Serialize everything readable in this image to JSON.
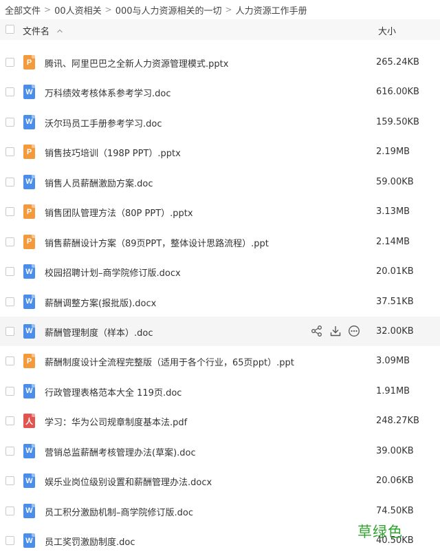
{
  "breadcrumb": {
    "items": [
      "全部文件",
      "00人资相关",
      "000与人力资源相关的一切",
      "人力资源工作手册"
    ],
    "separator": ">"
  },
  "table": {
    "header_name": "文件名",
    "header_size": "大小",
    "rows": [
      {
        "name": "腾讯、阿里巴巴之全新人力资源管理模式.pptx",
        "size": "265.24KB",
        "type": "ppt",
        "icon": "P"
      },
      {
        "name": "万科绩效考核体系参考学习.doc",
        "size": "616.00KB",
        "type": "word",
        "icon": "W"
      },
      {
        "name": "沃尔玛员工手册参考学习.doc",
        "size": "159.50KB",
        "type": "word",
        "icon": "W"
      },
      {
        "name": "销售技巧培训（198P PPT）.pptx",
        "size": "2.19MB",
        "type": "ppt",
        "icon": "P"
      },
      {
        "name": "销售人员薪酬激励方案.doc",
        "size": "59.00KB",
        "type": "word",
        "icon": "W"
      },
      {
        "name": "销售团队管理方法（80P PPT）.pptx",
        "size": "3.13MB",
        "type": "ppt",
        "icon": "P"
      },
      {
        "name": "销售薪酬设计方案（89页PPT，整体设计思路流程）.ppt",
        "size": "2.14MB",
        "type": "ppt",
        "icon": "P"
      },
      {
        "name": "校园招聘计划–商学院修订版.docx",
        "size": "20.01KB",
        "type": "word",
        "icon": "W"
      },
      {
        "name": "薪酬调整方案(报批版).docx",
        "size": "37.51KB",
        "type": "word",
        "icon": "W"
      },
      {
        "name": "薪酬管理制度（样本）.doc",
        "size": "32.00KB",
        "type": "word",
        "icon": "W"
      },
      {
        "name": "薪酬制度设计全流程完整版（适用于各个行业，65页ppt）.ppt",
        "size": "3.09MB",
        "type": "ppt",
        "icon": "P"
      },
      {
        "name": "行政管理表格范本大全 119页.doc",
        "size": "1.91MB",
        "type": "word",
        "icon": "W"
      },
      {
        "name": "学习：华为公司规章制度基本法.pdf",
        "size": "248.27KB",
        "type": "pdf",
        "icon": "人"
      },
      {
        "name": "营销总监薪酬考核管理办法(草案).doc",
        "size": "39.00KB",
        "type": "word",
        "icon": "W"
      },
      {
        "name": "娱乐业岗位级别设置和薪酬管理办法.docx",
        "size": "20.06KB",
        "type": "word",
        "icon": "W"
      },
      {
        "name": "员工积分激励机制–商学院修订版.doc",
        "size": "74.50KB",
        "type": "word",
        "icon": "W"
      },
      {
        "name": "员工奖罚激励制度.doc",
        "size": "40.50KB",
        "type": "word",
        "icon": "W"
      }
    ],
    "hover_row_index": 9
  },
  "watermark": "草绿色",
  "colors": {
    "ppt": "#f39a3d",
    "word": "#4a8eea",
    "pdf": "#e2544f",
    "header_bg": "#f7f7f8",
    "hover_bg": "#f5f5f6",
    "watermark": "#2ea52e"
  }
}
